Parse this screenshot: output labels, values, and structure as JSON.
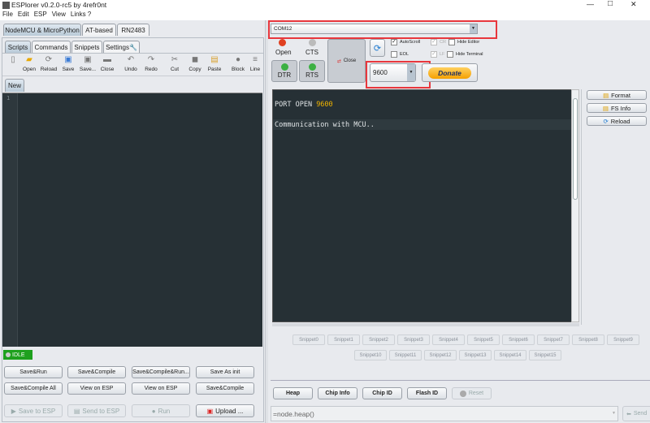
{
  "window": {
    "title": "ESPlorer v0.2.0-rc5 by 4refr0nt",
    "minimize": "—",
    "maximize": "□",
    "close": "✕"
  },
  "menu": [
    "File",
    "Edit",
    "ESP",
    "View",
    "Links ?"
  ],
  "left": {
    "device_tabs": [
      "NodeMCU & MicroPython",
      "AT-based",
      "RN2483"
    ],
    "tabs": [
      "Scripts",
      "Commands",
      "Snippets",
      "Settings"
    ],
    "toolbar": [
      "Open",
      "Reload",
      "Save",
      "Save...",
      "Close",
      "Undo",
      "Redo",
      "Cut",
      "Copy",
      "Paste",
      "Block",
      "Line"
    ],
    "file_tab": "New",
    "line_number": "1",
    "status": "IDLE",
    "buttons_row1": [
      "Save&Run",
      "Save&Compile",
      "Save&Compile&Run...",
      "Save As init"
    ],
    "buttons_row2": [
      "Save&Compile All",
      "View on ESP",
      "View on ESP",
      "Save&Compile"
    ],
    "save_to_esp": "Save to ESP",
    "send_to_esp": "Send to ESP",
    "run": "Run",
    "upload": "Upload ..."
  },
  "right": {
    "port": "COM12",
    "open": "Open",
    "cts": "CTS",
    "dtr": "DTR",
    "rts": "RTS",
    "close": "Close",
    "autoscroll": "AutoScroll",
    "eol": "EOL",
    "cr": "CR",
    "lf": "LF",
    "hide_editor": "Hide Editor",
    "hide_terminal": "Hide Terminal",
    "baud": "9600",
    "donate": "Donate",
    "terminal": {
      "line1_prefix": "PORT OPEN ",
      "line1_value": "9600",
      "line2": "Communication with MCU.."
    },
    "side_buttons": [
      "Format",
      "FS Info",
      "Reload"
    ],
    "snippets": [
      "Snippet0",
      "Snippet1",
      "Snippet2",
      "Snippet3",
      "Snippet4",
      "Snippet5",
      "Snippet6",
      "Snippet7",
      "Snippet8",
      "Snippet9",
      "Snippet10",
      "Snippet11",
      "Snippet12",
      "Snippet13",
      "Snippet14",
      "Snippet15"
    ],
    "commands": [
      "Heap",
      "Chip Info",
      "Chip ID",
      "Flash ID",
      "Reset"
    ],
    "command_input": "=node.heap()",
    "send": "Send"
  },
  "colors": {
    "highlight": "#e8373d",
    "terminal_bg": "#263035",
    "value": "#f0b400",
    "led_open": "#e04020",
    "led_on": "#3cb043"
  }
}
